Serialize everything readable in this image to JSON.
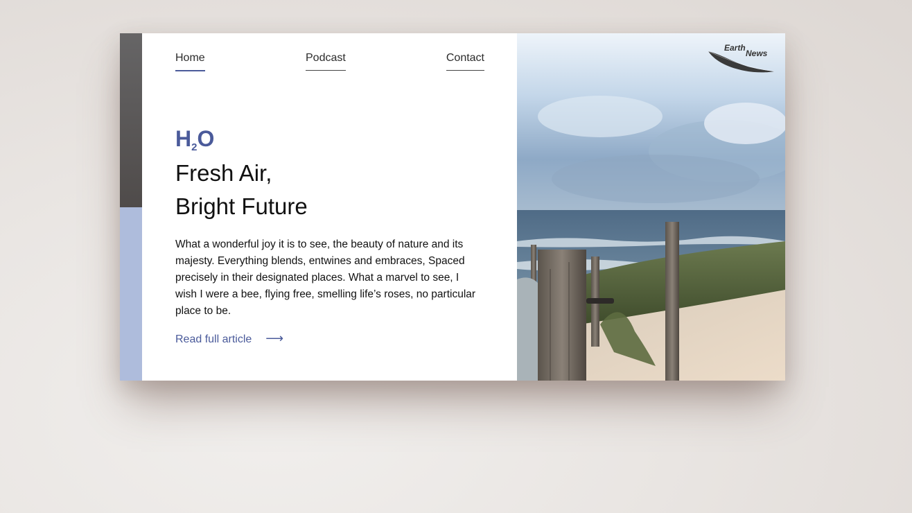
{
  "nav": {
    "items": [
      {
        "label": "Home",
        "active": true
      },
      {
        "label": "Podcast",
        "active": false
      },
      {
        "label": "Contact",
        "active": false
      }
    ]
  },
  "hero": {
    "kicker_main": "H",
    "kicker_sub": "2",
    "kicker_end": "O",
    "headline_line1": "Fresh Air,",
    "headline_line2": "Bright Future",
    "body": "What a wonderful joy it is to see, the beauty of nature and its majesty. Everything blends, entwines and embraces, Spaced precisely in their designated places. What a marvel to see, I wish I were a bee, flying free, smelling life’s roses, no particular place to be.",
    "cta_label": "Read full article",
    "cta_arrow": "⟶"
  },
  "logo": {
    "word1": "Earth",
    "word2": "News",
    "icon": "feather-icon"
  },
  "colors": {
    "accent": "#4a5a9a",
    "accent_bar_dark": "#5a5758",
    "accent_bar_light": "#aebcdc"
  }
}
